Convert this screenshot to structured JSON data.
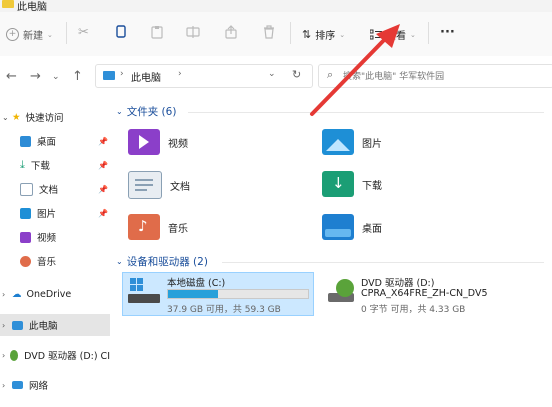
{
  "window": {
    "title": "此电脑"
  },
  "toolbar": {
    "new_label": "新建",
    "sort_label": "排序",
    "view_label": "查看",
    "more_label": "···"
  },
  "address": {
    "path": "此电脑",
    "search_placeholder": "搜索\"此电脑\"  华军软件园"
  },
  "sidebar": {
    "items": [
      {
        "label": "快速访问",
        "icon": "star-icon"
      },
      {
        "label": "桌面",
        "icon": "desktop-icon",
        "pinned": true
      },
      {
        "label": "下载",
        "icon": "download-icon",
        "pinned": true
      },
      {
        "label": "文档",
        "icon": "document-icon",
        "pinned": true
      },
      {
        "label": "图片",
        "icon": "picture-icon",
        "pinned": true
      },
      {
        "label": "视频",
        "icon": "video-icon"
      },
      {
        "label": "音乐",
        "icon": "music-icon"
      },
      {
        "label": "OneDrive",
        "icon": "cloud-icon"
      },
      {
        "label": "此电脑",
        "icon": "computer-icon"
      },
      {
        "label": "DVD 驱动器 (D:) CI",
        "icon": "dvd-icon"
      },
      {
        "label": "网络",
        "icon": "network-icon"
      }
    ]
  },
  "folders_section": {
    "title": "文件夹 (6)",
    "items": [
      {
        "label": "视频",
        "icon": "video-folder-icon",
        "color": "#8b3fc9"
      },
      {
        "label": "图片",
        "icon": "picture-folder-icon",
        "color": "#1e8fd6"
      },
      {
        "label": "文档",
        "icon": "document-folder-icon",
        "color": "#8aa0b4"
      },
      {
        "label": "下载",
        "icon": "download-folder-icon",
        "color": "#1b9e75"
      },
      {
        "label": "音乐",
        "icon": "music-folder-icon",
        "color": "#e06c4a"
      },
      {
        "label": "桌面",
        "icon": "desktop-folder-icon",
        "color": "#1e7fd0"
      }
    ]
  },
  "drives_section": {
    "title": "设备和驱动器 (2)",
    "drives": [
      {
        "name": "本地磁盘 (C:)",
        "space": "37.9 GB 可用，共 59.3 GB",
        "used_fraction": 0.36,
        "icon": "windows-drive-icon"
      },
      {
        "name": "DVD 驱动器 (D:)",
        "label2": "CPRA_X64FRE_ZH-CN_DV5",
        "space": "0 字节 可用，共 4.33 GB",
        "icon": "dvd-disc-icon"
      }
    ]
  },
  "colors": {
    "accent": "#1a4e9b",
    "selection": "#cce8ff",
    "arrow": "#e53935"
  }
}
